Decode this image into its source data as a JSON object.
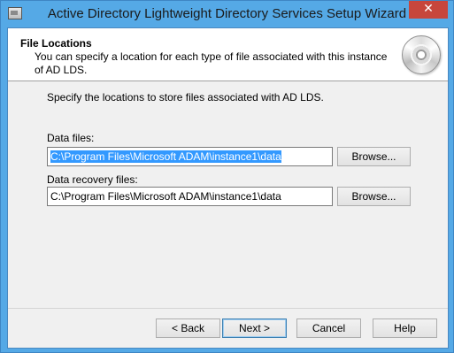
{
  "window": {
    "title": "Active Directory Lightweight Directory Services Setup Wizard",
    "close_glyph": "✕"
  },
  "header": {
    "title": "File Locations",
    "subtitle": "You can specify a location for each type of file associated with this instance of AD LDS."
  },
  "body": {
    "instruction": "Specify the locations to store files associated with AD LDS.",
    "data_files": {
      "label": "Data files:",
      "value": "C:\\Program Files\\Microsoft ADAM\\instance1\\data",
      "browse_label": "Browse..."
    },
    "recovery_files": {
      "label": "Data recovery files:",
      "value": "C:\\Program Files\\Microsoft ADAM\\instance1\\data",
      "browse_label": "Browse..."
    }
  },
  "footer": {
    "back_label": "< Back",
    "next_label": "Next >",
    "cancel_label": "Cancel",
    "help_label": "Help"
  },
  "icons": {
    "app": "wizard-app-icon",
    "disc": "cd-disc-icon"
  },
  "colors": {
    "titlebar": "#55a9e6",
    "close": "#c7463c",
    "selection": "#3399ff"
  }
}
